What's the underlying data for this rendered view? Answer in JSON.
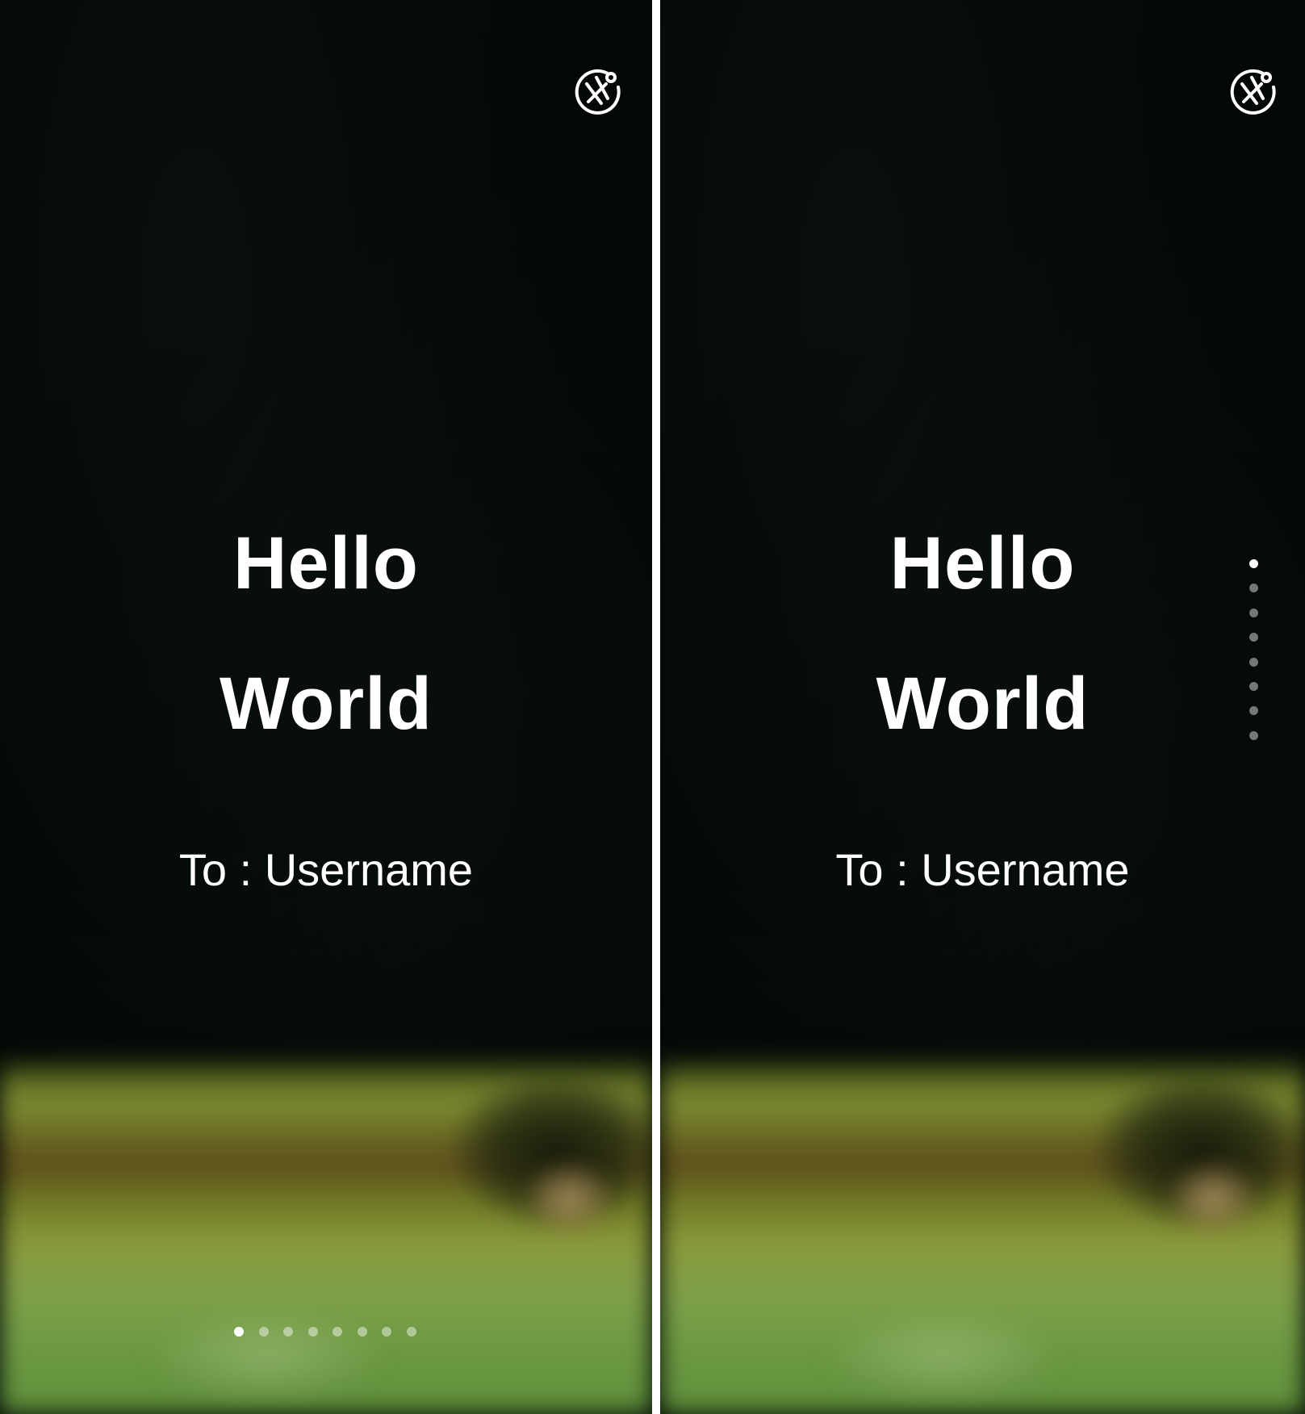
{
  "screens": [
    {
      "id": "horizontal-pager",
      "title_line1": "Hello",
      "title_line2": "World",
      "recipient": "To : Username",
      "pager": {
        "orientation": "horizontal",
        "count": 8,
        "active_index": 0
      },
      "top_right_icon": "location-disabled-icon"
    },
    {
      "id": "vertical-pager",
      "title_line1": "Hello",
      "title_line2": "World",
      "recipient": "To : Username",
      "pager": {
        "orientation": "vertical",
        "count": 8,
        "active_index": 0
      },
      "top_right_icon": "location-disabled-icon"
    }
  ],
  "colors": {
    "text": "#ffffff",
    "background_dark": "#020806",
    "field_green": "#7e8d33",
    "dot_active": "#ffffff",
    "dot_inactive": "rgba(255,255,255,0.45)",
    "divider": "#ffffff"
  }
}
